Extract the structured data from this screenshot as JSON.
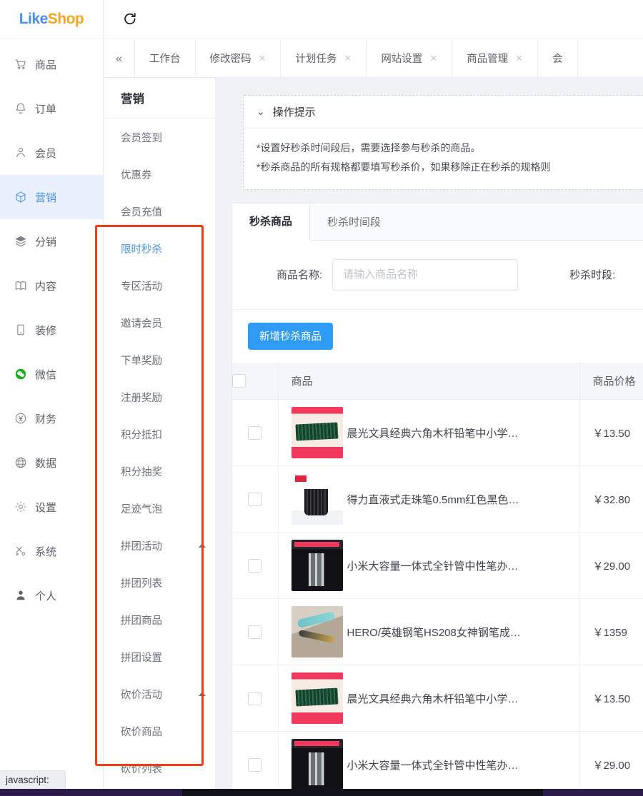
{
  "brand": {
    "part1": "Like",
    "part2": "Shop"
  },
  "topbar": {
    "refresh_icon": "refresh-icon"
  },
  "tabstrip": {
    "collapse_icon": "chevron-double-left-icon",
    "tabs": [
      {
        "label": "工作台",
        "closable": false
      },
      {
        "label": "修改密码",
        "closable": true
      },
      {
        "label": "计划任务",
        "closable": true
      },
      {
        "label": "网站设置",
        "closable": true
      },
      {
        "label": "商品管理",
        "closable": true
      },
      {
        "label": "会",
        "closable": false
      }
    ]
  },
  "sidebar": {
    "items": [
      {
        "label": "商品",
        "icon": "cart-icon",
        "active": false
      },
      {
        "label": "订单",
        "icon": "bell-icon",
        "active": false
      },
      {
        "label": "会员",
        "icon": "user-icon",
        "active": false
      },
      {
        "label": "营销",
        "icon": "cube-icon",
        "active": true
      },
      {
        "label": "分销",
        "icon": "layers-icon",
        "active": false
      },
      {
        "label": "内容",
        "icon": "book-icon",
        "active": false
      },
      {
        "label": "装修",
        "icon": "mobile-icon",
        "active": false
      },
      {
        "label": "微信",
        "icon": "wechat-icon",
        "active": false
      },
      {
        "label": "财务",
        "icon": "yen-circle-icon",
        "active": false
      },
      {
        "label": "数据",
        "icon": "globe-icon",
        "active": false
      },
      {
        "label": "设置",
        "icon": "gear-icon",
        "active": false
      },
      {
        "label": "系统",
        "icon": "tools-icon",
        "active": false
      },
      {
        "label": "个人",
        "icon": "person-filled-icon",
        "active": false
      }
    ]
  },
  "submenu": {
    "title": "营销",
    "items": [
      {
        "label": "会员签到",
        "active": false,
        "arrow": false
      },
      {
        "label": "优惠券",
        "active": false,
        "arrow": false
      },
      {
        "label": "会员充值",
        "active": false,
        "arrow": false
      },
      {
        "label": "限时秒杀",
        "active": true,
        "arrow": false
      },
      {
        "label": "专区活动",
        "active": false,
        "arrow": false
      },
      {
        "label": "邀请会员",
        "active": false,
        "arrow": false
      },
      {
        "label": "下单奖励",
        "active": false,
        "arrow": false
      },
      {
        "label": "注册奖励",
        "active": false,
        "arrow": false
      },
      {
        "label": "积分抵扣",
        "active": false,
        "arrow": false
      },
      {
        "label": "积分抽奖",
        "active": false,
        "arrow": false
      },
      {
        "label": "足迹气泡",
        "active": false,
        "arrow": false
      },
      {
        "label": "拼团活动",
        "active": false,
        "arrow": true
      },
      {
        "label": "拼团列表",
        "active": false,
        "arrow": false
      },
      {
        "label": "拼团商品",
        "active": false,
        "arrow": false
      },
      {
        "label": "拼团设置",
        "active": false,
        "arrow": false
      },
      {
        "label": "砍价活动",
        "active": false,
        "arrow": true
      },
      {
        "label": "砍价商品",
        "active": false,
        "arrow": false
      },
      {
        "label": "砍价列表",
        "active": false,
        "arrow": false
      }
    ]
  },
  "tip": {
    "toggle_icon": "chevron-down-icon",
    "title": "操作提示",
    "lines": [
      "*设置好秒杀时间段后，需要选择参与秒杀的商品。",
      "*秒杀商品的所有规格都要填写秒杀价，如果移除正在秒杀的规格则"
    ]
  },
  "panel": {
    "tabs": [
      {
        "label": "秒杀商品",
        "active": true
      },
      {
        "label": "秒杀时间段",
        "active": false
      }
    ],
    "filters": {
      "name_label": "商品名称:",
      "name_value": "",
      "name_placeholder": "请输入商品名称",
      "period_label": "秒杀时段:"
    },
    "add_button": "新增秒杀商品",
    "table": {
      "columns": [
        "",
        "商品",
        "商品价格"
      ],
      "header_select_all": "select-all-checkbox",
      "rows": [
        {
          "name": "晨光文具经典六角木杆铅笔中小学…",
          "price": "￥13.50",
          "thumb": "t-pencil",
          "play": false
        },
        {
          "name": "得力直液式走珠笔0.5mm红色黑色…",
          "price": "￥32.80",
          "thumb": "t-deli",
          "play": true
        },
        {
          "name": "小米大容量一体式全针管中性笔办…",
          "price": "￥29.00",
          "thumb": "t-mi",
          "play": false
        },
        {
          "name": "HERO/英雄钢笔HS208女神钢笔成…",
          "price": "￥1359",
          "thumb": "t-hero",
          "play": false
        },
        {
          "name": "晨光文具经典六角木杆铅笔中小学…",
          "price": "￥13.50",
          "thumb": "t-pencil",
          "play": false
        },
        {
          "name": "小米大容量一体式全针管中性笔办…",
          "price": "￥29.00",
          "thumb": "t-mi",
          "play": false
        }
      ]
    }
  },
  "status": {
    "text": "javascript:"
  },
  "colors": {
    "brand_blue": "#4a90e8",
    "brand_orange": "#f5a623",
    "accent_button": "#2f9bf4",
    "annotation_red": "#f03c14",
    "active_bg": "#e8f1fd",
    "content_bg": "#f0f2f5"
  }
}
